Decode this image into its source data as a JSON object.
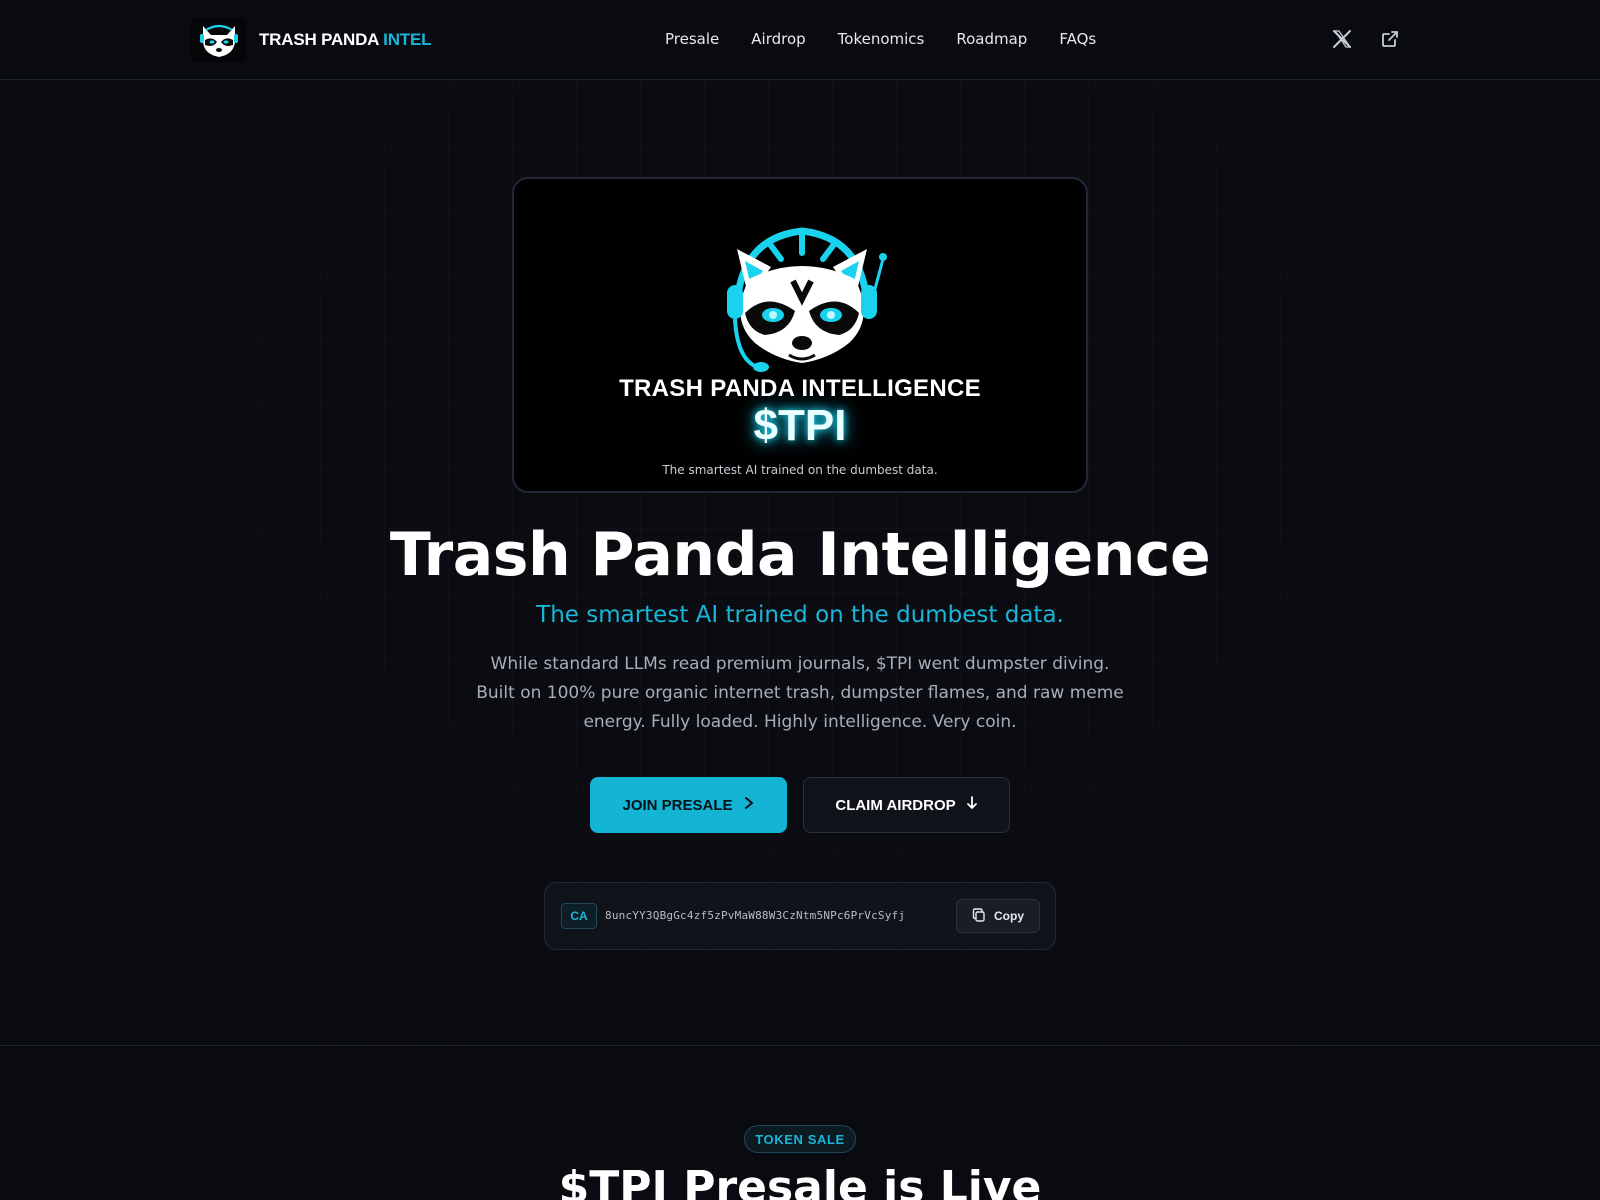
{
  "header": {
    "brand_name": "TRASH PANDA",
    "brand_accent": "INTEL",
    "nav": [
      "Presale",
      "Airdrop",
      "Tokenomics",
      "Roadmap",
      "FAQs"
    ],
    "icons": [
      "x-logo-icon",
      "external-link-icon"
    ]
  },
  "hero": {
    "banner": {
      "title": "TRASH PANDA INTELLIGENCE",
      "ticker": "$TPI",
      "tagline": "The smartest AI trained on the dumbest data."
    },
    "title": "Trash Panda Intelligence",
    "subtitle": "The smartest AI trained on the dumbest data.",
    "description": "While standard LLMs read premium journals, $TPI went dumpster diving. Built on 100% pure organic internet trash, dumpster flames, and raw meme energy. Fully loaded. Highly intelligence. Very coin.",
    "primary_button": "JOIN PRESALE",
    "secondary_button": "CLAIM AIRDROP",
    "contract": {
      "label": "CA",
      "address": "8uncYY3QBgGc4zf5zPvMaW88W3CzNtm5NPc6PrVcSyfj",
      "copy_label": "Copy"
    }
  },
  "token_sale": {
    "badge": "TOKEN SALE",
    "title": "$TPI Presale is Live"
  },
  "colors": {
    "accent": "#19b6d8",
    "background": "#0a0b10",
    "button_primary": "#14b4d4"
  }
}
